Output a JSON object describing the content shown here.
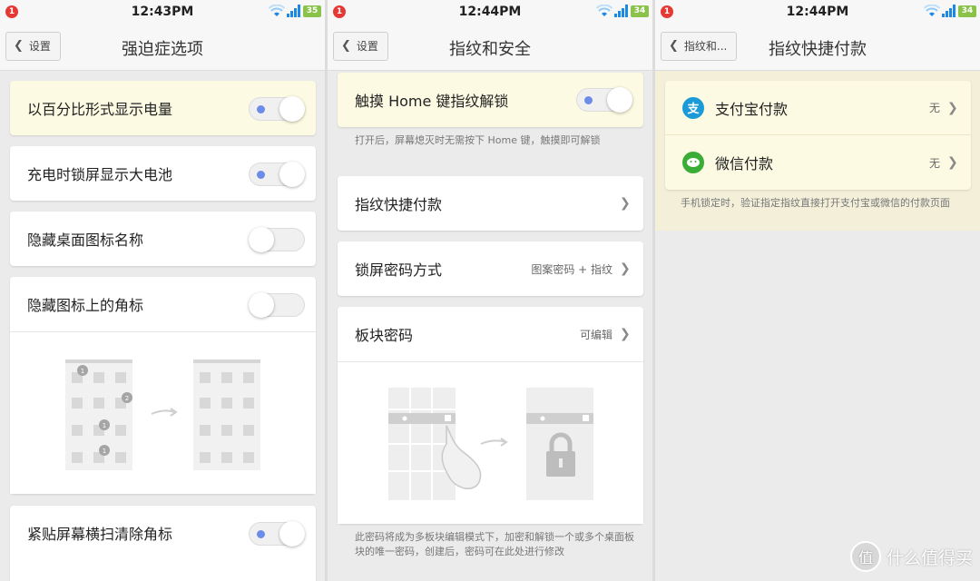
{
  "screens": [
    {
      "status": {
        "notif": "1",
        "time": "12:43PM",
        "battery": "35"
      },
      "back_label": "设置",
      "title": "强迫症选项",
      "settings": [
        {
          "label": "以百分比形式显示电量",
          "enabled": true
        },
        {
          "label": "充电时锁屏显示大电池",
          "enabled": true
        },
        {
          "label": "隐藏桌面图标名称",
          "enabled": false
        },
        {
          "label": "隐藏图标上的角标",
          "enabled": false
        },
        {
          "label": "紧贴屏幕横扫清除角标",
          "enabled": true
        }
      ],
      "badge_counts": [
        "1",
        "2",
        "1",
        "1"
      ]
    },
    {
      "status": {
        "notif": "1",
        "time": "12:44PM",
        "battery": "34"
      },
      "back_label": "设置",
      "title": "指纹和安全",
      "home_unlock": {
        "label": "触摸 Home 键指纹解锁",
        "enabled": true,
        "note": "打开后，屏幕熄灭时无需按下 Home 键，触摸即可解锁"
      },
      "quick_pay": {
        "label": "指纹快捷付款"
      },
      "lock_method": {
        "label": "锁屏密码方式",
        "value": "图案密码 + 指纹"
      },
      "block_password": {
        "label": "板块密码",
        "value": "可编辑"
      },
      "block_note": "此密码将成为多板块编辑模式下，加密和解锁一个或多个桌面板块的唯一密码，创建后，密码可在此处进行修改"
    },
    {
      "status": {
        "notif": "1",
        "time": "12:44PM",
        "battery": "34"
      },
      "back_label": "指纹和...",
      "title": "指纹快捷付款",
      "payments": [
        {
          "label": "支付宝付款",
          "value": "无",
          "icon": "alipay-icon",
          "color": "#1a9bd7",
          "glyph": "支"
        },
        {
          "label": "微信付款",
          "value": "无",
          "icon": "wechat-icon",
          "color": "#3aad36",
          "glyph": ""
        }
      ],
      "note": "手机锁定时，验证指定指纹直接打开支付宝或微信的付款页面"
    }
  ],
  "watermark": {
    "text": "什么值得买",
    "badge": "值"
  },
  "colors": {
    "highlight": "#fcfae2",
    "accent_dot": "#6c8ce8",
    "battery": "#8bc34a",
    "notif": "#e53935"
  }
}
